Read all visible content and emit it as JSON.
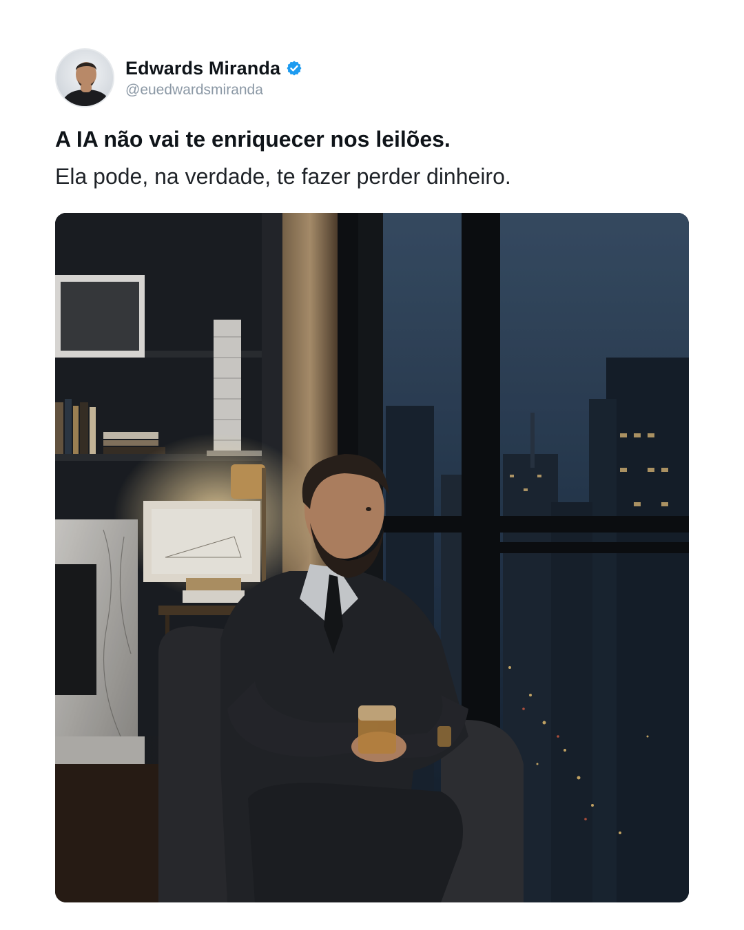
{
  "post": {
    "author": {
      "display_name": "Edwards Miranda",
      "handle": "@euedwardsmiranda",
      "verified": true,
      "avatar_icon": "person-avatar"
    },
    "headline": "A IA não vai te enriquecer nos leilões.",
    "body": "Ela pode, na verdade, te fazer perder dinheiro.",
    "media": {
      "kind": "photo",
      "icon": "photo-man-in-suit-by-city-window"
    },
    "colors": {
      "verified_badge": "#1d9bf0",
      "handle_text": "#8b98a5",
      "text": "#0f1419"
    }
  }
}
